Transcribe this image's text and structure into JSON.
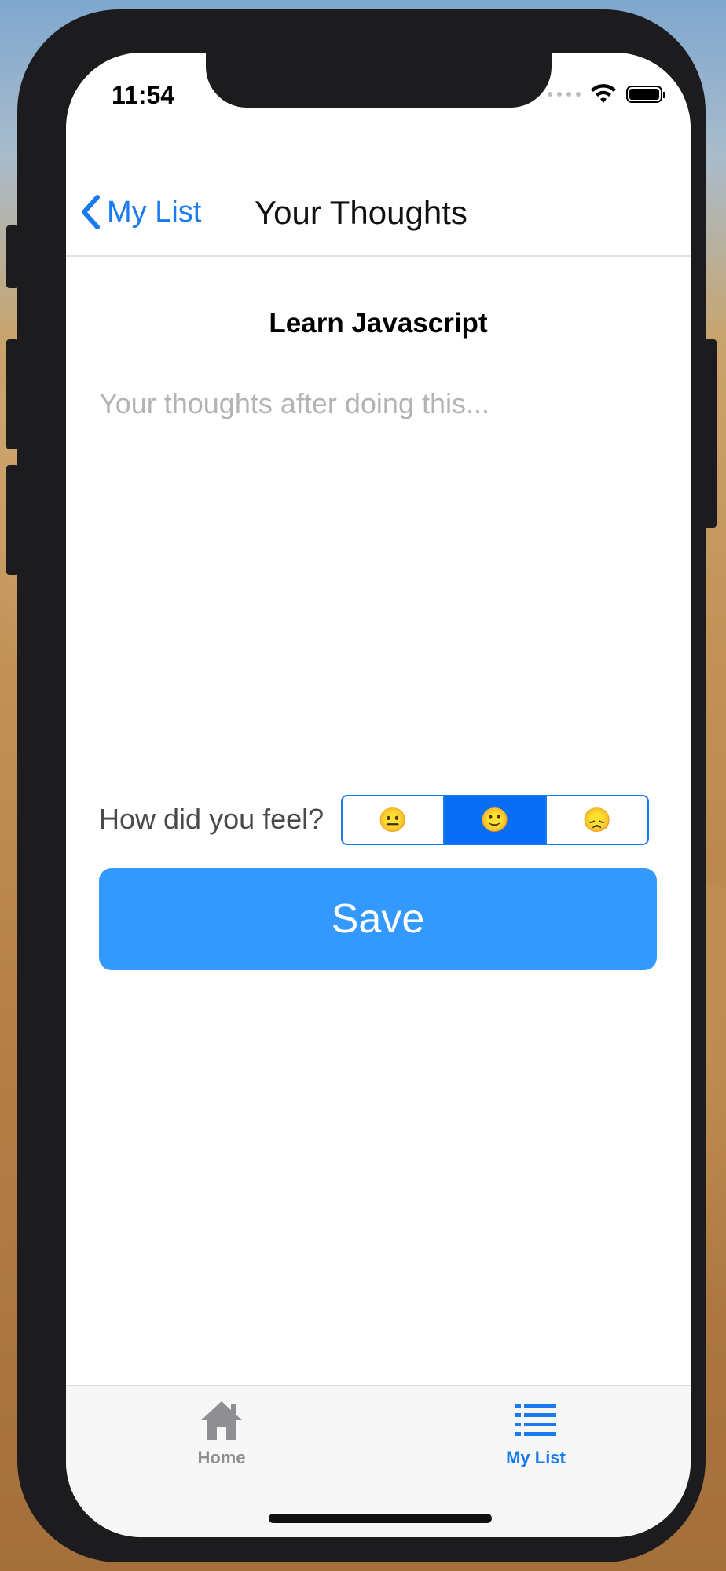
{
  "status_bar": {
    "time": "11:54"
  },
  "navbar": {
    "back_label": "My List",
    "title": "Your Thoughts"
  },
  "content": {
    "item_title": "Learn Javascript",
    "thoughts_placeholder": "Your thoughts after doing this...",
    "thoughts_value": ""
  },
  "feeling": {
    "label": "How did you feel?",
    "options": [
      "😐",
      "🙂",
      "😞"
    ],
    "selected_index": 1
  },
  "save_button": {
    "label": "Save"
  },
  "tabbar": {
    "tabs": [
      {
        "label": "Home",
        "icon": "home-icon",
        "active": false
      },
      {
        "label": "My List",
        "icon": "list-icon",
        "active": true
      }
    ]
  },
  "colors": {
    "accent": "#1a7bf0",
    "segment_active": "#0a6df5",
    "save_button": "#3399ff",
    "placeholder": "#b3b3b3",
    "inactive_tab": "#8e8e93"
  }
}
